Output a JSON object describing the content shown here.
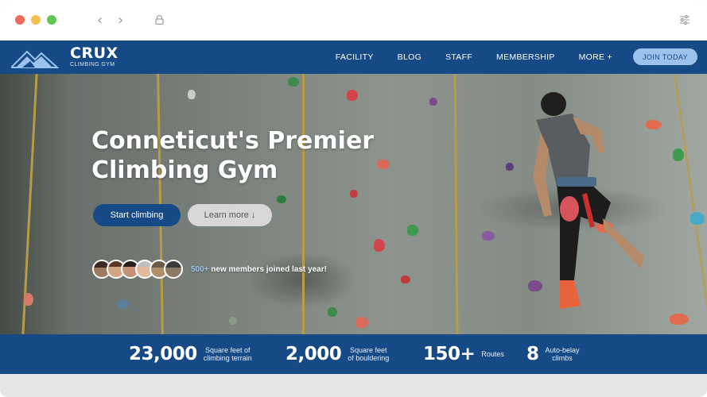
{
  "browser": {
    "back_glyph": "‹",
    "forward_glyph": "›",
    "icons": [
      "lock-icon",
      "sliders-icon"
    ]
  },
  "site": {
    "logo": {
      "title": "CRUX",
      "subtitle": "CLIMBING GYM"
    },
    "nav": {
      "items": [
        {
          "label": "FACILITY"
        },
        {
          "label": "BLOG"
        },
        {
          "label": "STAFF"
        },
        {
          "label": "MEMBERSHIP"
        },
        {
          "label": "MORE +"
        }
      ],
      "cta_label": "JOIN TODAY"
    },
    "hero": {
      "headline_line1": "Conneticut's Premier",
      "headline_line2": "Climbing Gym",
      "primary_button": "Start climbing",
      "secondary_button": "Learn more ↓",
      "members_count": "500+",
      "members_text": " new members joined last year!",
      "avatar_count": 6
    },
    "stats": [
      {
        "value": "23,000",
        "label_line1": "Square feet of",
        "label_line2": "climbing terrain"
      },
      {
        "value": "2,000",
        "label_line1": "Square feet",
        "label_line2": "of bouldering"
      },
      {
        "value": "150+",
        "label_line1": "Routes",
        "label_line2": ""
      },
      {
        "value": "8",
        "label_line1": "Auto-belay",
        "label_line2": "climbs"
      }
    ]
  },
  "colors": {
    "brand_blue": "#154a86",
    "accent_light_blue": "#9bc3ee",
    "window_red": "#ec6a5e",
    "window_yellow": "#f4bf4f",
    "window_green": "#61c554"
  }
}
